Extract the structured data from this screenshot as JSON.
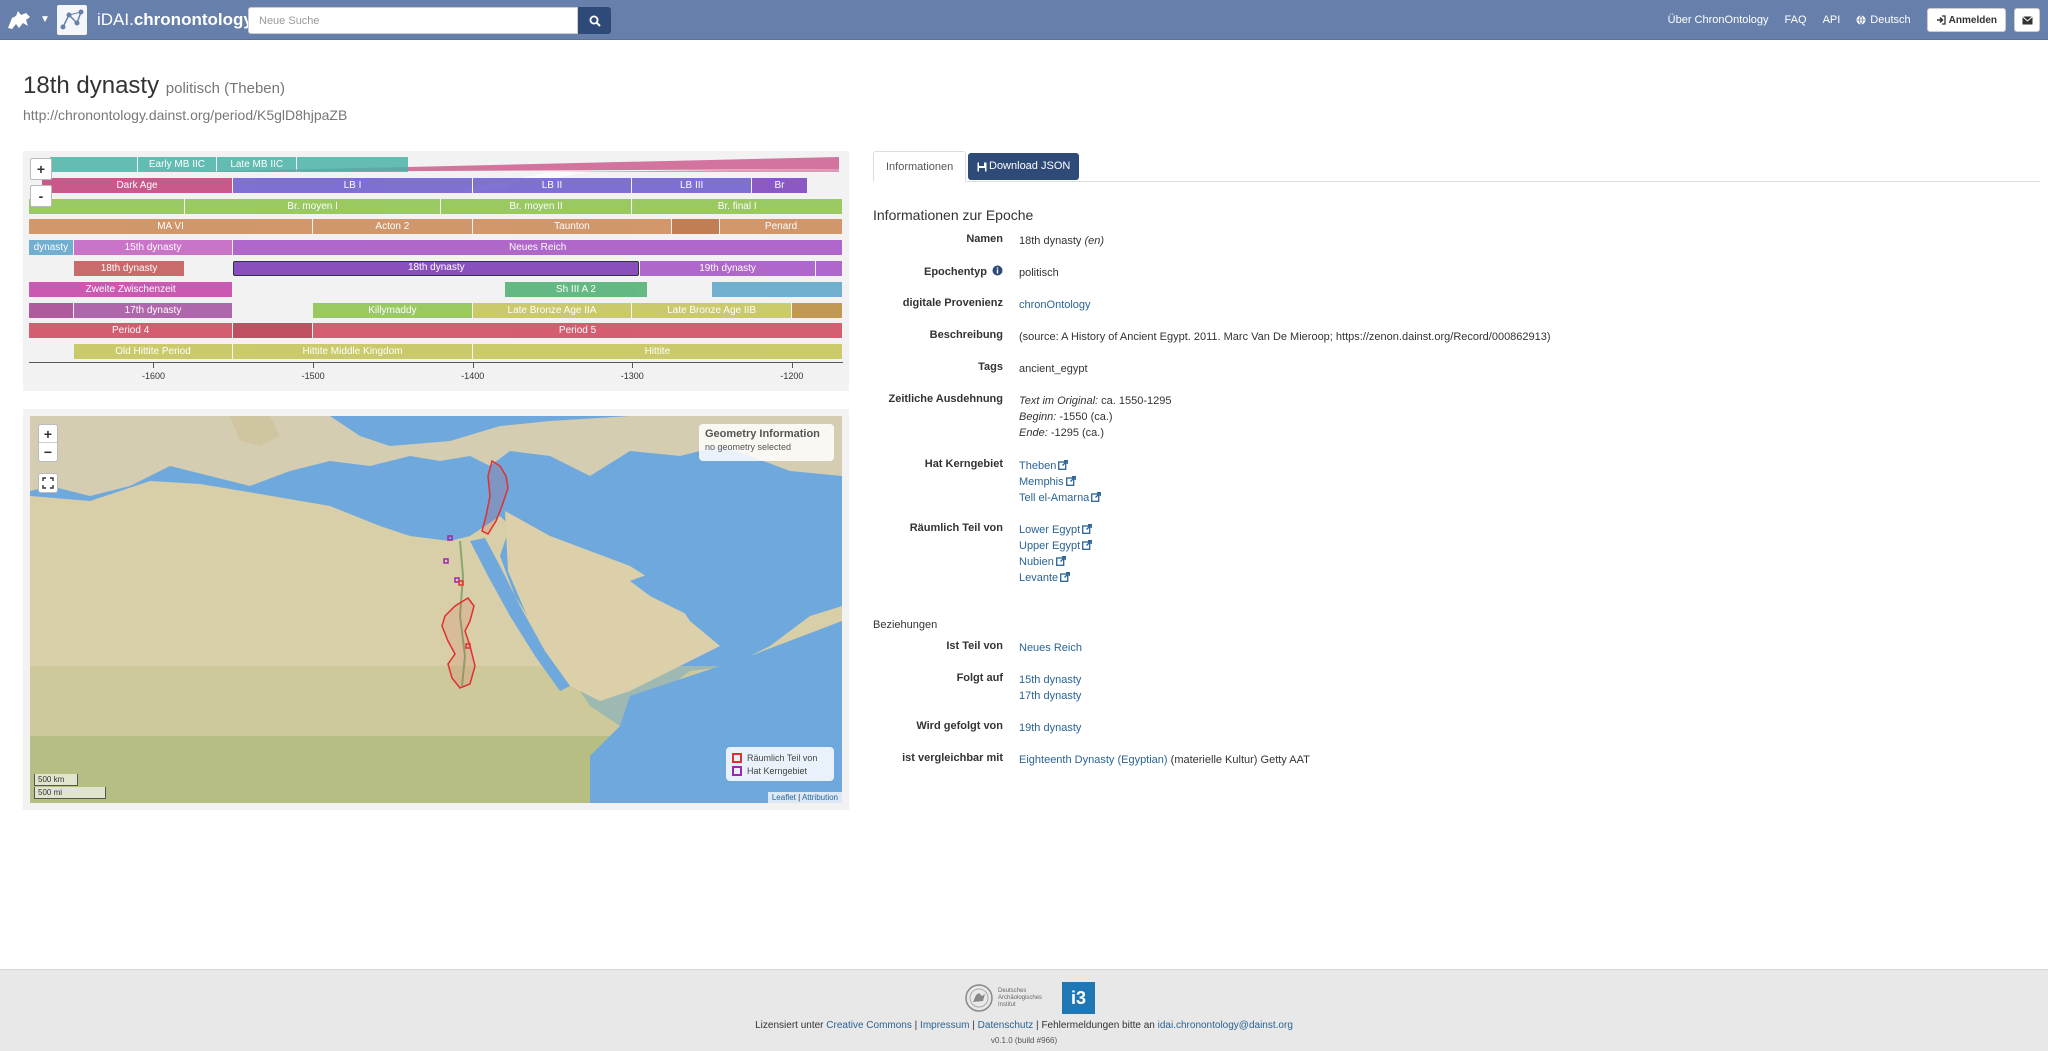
{
  "nav": {
    "brand_prefix": "iDAI.",
    "brand_name": "chronontology",
    "search_placeholder": "Neue Suche",
    "links": [
      "Über ChronOntology",
      "FAQ",
      "API"
    ],
    "language": "Deutsch",
    "login": "Anmelden"
  },
  "period": {
    "title": "18th dynasty",
    "subtitle": "politisch (Theben)",
    "uri": "http://chronontology.dainst.org/period/K5glD8hjpaZB"
  },
  "timeline": {
    "bars": [
      {
        "label": "",
        "row": 0,
        "start": -1665,
        "end": -1610,
        "color": "#4bb3a7"
      },
      {
        "label": "Early MB IIC",
        "row": 0,
        "start": -1610,
        "end": -1560,
        "color": "#4bb3a7"
      },
      {
        "label": "Late MB IIC",
        "row": 0,
        "start": -1560,
        "end": -1510,
        "color": "#4bb3a7"
      },
      {
        "label": "",
        "row": 0,
        "start": -1510,
        "end": -1440,
        "color": "#4bb3a7"
      },
      {
        "label": "Dark Age",
        "row": 1,
        "start": -1670,
        "end": -1550,
        "color": "#c43f7a"
      },
      {
        "label": "LB I",
        "row": 1,
        "start": -1550,
        "end": -1400,
        "color": "#6a5acd"
      },
      {
        "label": "LB II",
        "row": 1,
        "start": -1400,
        "end": -1300,
        "color": "#6a5acd"
      },
      {
        "label": "LB III",
        "row": 1,
        "start": -1300,
        "end": -1225,
        "color": "#6a5acd"
      },
      {
        "label": "Br",
        "row": 1,
        "start": -1225,
        "end": -1190,
        "color": "#7a3fbf"
      },
      {
        "label": "",
        "row": 2,
        "start": -1680,
        "end": -1580,
        "color": "#8bc34a"
      },
      {
        "label": "Br. moyen I",
        "row": 2,
        "start": -1580,
        "end": -1420,
        "color": "#8bc34a"
      },
      {
        "label": "Br. moyen II",
        "row": 2,
        "start": -1420,
        "end": -1300,
        "color": "#8bc34a"
      },
      {
        "label": "Br. final I",
        "row": 2,
        "start": -1300,
        "end": -1160,
        "color": "#8bc34a"
      },
      {
        "label": "MA VI",
        "row": 3,
        "start": -1700,
        "end": -1500,
        "color": "#cc8855"
      },
      {
        "label": "Acton 2",
        "row": 3,
        "start": -1500,
        "end": -1400,
        "color": "#cc8855"
      },
      {
        "label": "Taunton",
        "row": 3,
        "start": -1400,
        "end": -1275,
        "color": "#cc8855"
      },
      {
        "label": "",
        "row": 3,
        "start": -1275,
        "end": -1245,
        "color": "#b86a3a"
      },
      {
        "label": "Penard",
        "row": 3,
        "start": -1245,
        "end": -1160,
        "color": "#cc8855"
      },
      {
        "label": "dynasty",
        "row": 4,
        "start": -1680,
        "end": -1650,
        "color": "#5ba3c9"
      },
      {
        "label": "15th dynasty",
        "row": 4,
        "start": -1650,
        "end": -1550,
        "color": "#c45fc0"
      },
      {
        "label": "Neues Reich",
        "row": 4,
        "start": -1550,
        "end": -1160,
        "color": "#a44fc4"
      },
      {
        "label": "18th dynasty",
        "row": 5,
        "start": -1650,
        "end": -1580,
        "color": "#c45454"
      },
      {
        "label": "18th dynasty",
        "row": 5,
        "start": -1550,
        "end": -1295,
        "color": "#8a4fbf",
        "selected": true
      },
      {
        "label": "19th dynasty",
        "row": 5,
        "start": -1295,
        "end": -1185,
        "color": "#a44fc4"
      },
      {
        "label": "",
        "row": 5,
        "start": -1185,
        "end": -1160,
        "color": "#a44fc4"
      },
      {
        "label": "Zweite Zwischenzeit",
        "row": 6,
        "start": -1700,
        "end": -1550,
        "color": "#c43fa8"
      },
      {
        "label": "Sh III A 2",
        "row": 6,
        "start": -1380,
        "end": -1290,
        "color": "#4caf70"
      },
      {
        "label": "",
        "row": 6,
        "start": -1250,
        "end": -1160,
        "color": "#5ba3c9"
      },
      {
        "label": "",
        "row": 7,
        "start": -1680,
        "end": -1650,
        "color": "#a43f8f"
      },
      {
        "label": "17th dynasty",
        "row": 7,
        "start": -1650,
        "end": -1550,
        "color": "#a44f9f"
      },
      {
        "label": "Killymaddy",
        "row": 7,
        "start": -1500,
        "end": -1400,
        "color": "#8bc34a"
      },
      {
        "label": "Late Bronze Age IIA",
        "row": 7,
        "start": -1400,
        "end": -1300,
        "color": "#c4c455"
      },
      {
        "label": "Late Bronze Age IIB",
        "row": 7,
        "start": -1300,
        "end": -1200,
        "color": "#c4c455"
      },
      {
        "label": "",
        "row": 7,
        "start": -1200,
        "end": -1160,
        "color": "#b88a3a"
      },
      {
        "label": "Period 4",
        "row": 8,
        "start": -1700,
        "end": -1550,
        "color": "#d0445a"
      },
      {
        "label": "",
        "row": 8,
        "start": -1550,
        "end": -1500,
        "color": "#b8334a"
      },
      {
        "label": "Period 5",
        "row": 8,
        "start": -1500,
        "end": -1160,
        "color": "#d0445a"
      },
      {
        "label": "Old Hittite Period",
        "row": 9,
        "start": -1650,
        "end": -1550,
        "color": "#c4c455"
      },
      {
        "label": "Hittite Middle Kingdom",
        "row": 9,
        "start": -1550,
        "end": -1400,
        "color": "#c4c455"
      },
      {
        "label": "Hittite",
        "row": 9,
        "start": -1400,
        "end": -1160,
        "color": "#c4c455"
      }
    ],
    "ticks": [
      -1600,
      -1500,
      -1400,
      -1300,
      -1200
    ],
    "range": [
      -1678,
      -1168
    ]
  },
  "map": {
    "info_title": "Geometry Information",
    "info_text": "no geometry selected",
    "legend": [
      {
        "label": "Räumlich Teil von",
        "color": "#e03030"
      },
      {
        "label": "Hat Kerngebiet",
        "color": "#9c27b0"
      }
    ],
    "scale_km": "500 km",
    "scale_mi": "500 mi",
    "attribution_leaflet": "Leaflet",
    "attribution_sep": "|",
    "attribution_text": "Attribution"
  },
  "panel": {
    "tab_info": "Informationen",
    "tab_download": "Download JSON",
    "heading": "Informationen zur Epoche",
    "name_label": "Namen",
    "name_value": "18th dynasty",
    "name_lang": "(en)",
    "type_label": "Epochentyp",
    "type_value": "politisch",
    "provenance_label": "digitale Provenienz",
    "provenance_value": "chronOntology",
    "description_label": "Beschreibung",
    "description_value": "(source: A History of Ancient Egypt. 2011. Marc Van De Mieroop; https://zenon.dainst.org/Record/000862913)",
    "tags_label": "Tags",
    "tags_value": "ancient_egypt",
    "time_label": "Zeitliche Ausdehnung",
    "time_original_label": "Text im Original:",
    "time_original_value": "ca. 1550-1295",
    "time_begin_label": "Beginn:",
    "time_begin_value": "-1550 (ca.)",
    "time_end_label": "Ende:",
    "time_end_value": "-1295 (ca.)",
    "core_label": "Hat Kerngebiet",
    "core_areas": [
      "Theben",
      "Memphis",
      "Tell el-Amarna"
    ],
    "spatial_label": "Räumlich Teil von",
    "spatial_areas": [
      "Lower Egypt",
      "Upper Egypt",
      "Nubien",
      "Levante"
    ],
    "relations_heading": "Beziehungen",
    "part_of_label": "Ist Teil von",
    "part_of_value": "Neues Reich",
    "follows_label": "Folgt auf",
    "follows_values": [
      "15th dynasty",
      "17th dynasty"
    ],
    "followed_by_label": "Wird gefolgt von",
    "followed_by_value": "19th dynasty",
    "comparable_label": "ist vergleichbar mit",
    "comparable_link": "Eighteenth Dynasty (Egyptian)",
    "comparable_rest": "(materielle Kultur) Getty AAT"
  },
  "footer": {
    "dai_text": "Deutsches Archäologisches Institut",
    "i3": "i3",
    "license_prefix": "Lizensiert unter",
    "license_link": "Creative Commons",
    "impressum": "Impressum",
    "datenschutz": "Datenschutz",
    "errors_prefix": "Fehlermeldungen bitte an",
    "email": "idai.chronontology@dainst.org",
    "sep": "|",
    "version": "v0.1.0 (build #966)"
  },
  "colors": {
    "navbar": "#6780ab",
    "primary_button": "#2e4a78",
    "link": "#2a6496"
  }
}
